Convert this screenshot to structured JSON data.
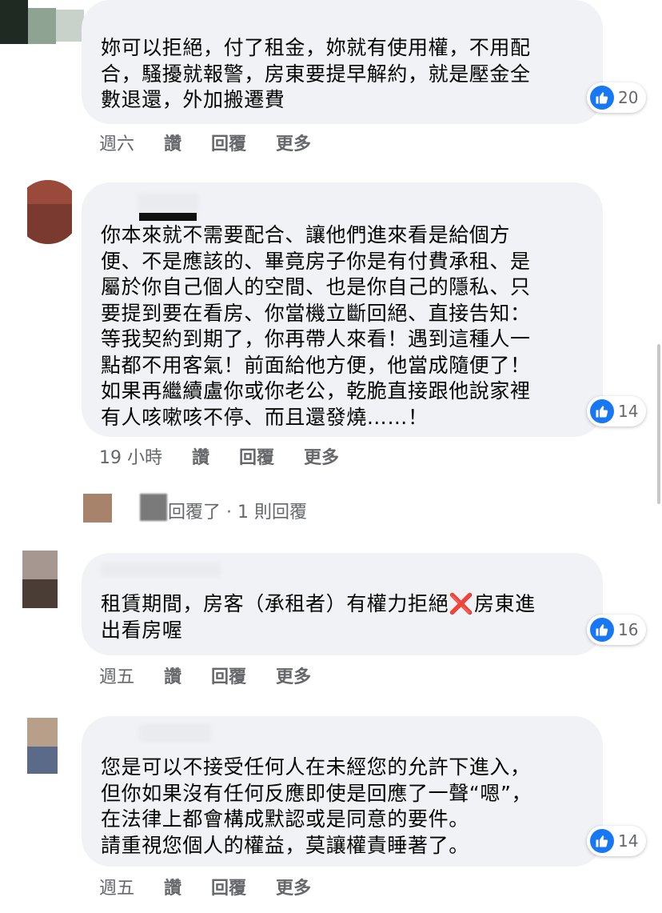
{
  "comments": [
    {
      "lines": [
        "妳可以拒絕，付了租金，妳就有使用權，不用配",
        "合，騷擾就報警，房東要提早解約，就是壓金全",
        "數退還，外加搬遷費"
      ],
      "time": "週六",
      "like": "讚",
      "reply": "回覆",
      "more": "更多",
      "reactions": "20"
    },
    {
      "lines": [
        "你本來就不需要配合、讓他們進來看是給個方",
        "便、不是應該的、畢竟房子你是有付費承租、是",
        "屬於你自己個人的空間、也是你自己的隱私、只",
        "要提到要在看房、你當機立斷回絕、直接告知：",
        "等我契約到期了，你再帶人來看！遇到這種人一",
        "點都不用客氣！前面給他方便，他當成隨便了！",
        "如果再繼續盧你或你老公，乾脆直接跟他說家裡",
        "有人咳嗽咳不停、而且還發燒……！"
      ],
      "time": "19 小時",
      "like": "讚",
      "reply": "回覆",
      "more": "更多",
      "reactions": "14",
      "replies_summary": "回覆了 · 1 則回覆"
    },
    {
      "line1_a": "租賃期間，房客（承租者）有權力拒絕",
      "line1_x": "❌",
      "line1_b": "房東進",
      "line2": "出看房喔",
      "time": "週五",
      "like": "讚",
      "reply": "回覆",
      "more": "更多",
      "reactions": "16"
    },
    {
      "lines": [
        "您是可以不接受任何人在未經您的允許下進入，",
        "但你如果沒有任何反應即使是回應了一聲“嗯”，",
        "在法律上都會構成默認或是同意的要件。",
        "請重視您個人的權益，莫讓權責睡著了。"
      ],
      "time": "週五",
      "like": "讚",
      "reply": "回覆",
      "more": "更多",
      "reactions": "14"
    }
  ],
  "colors": {
    "bubble": "#f0f2f5",
    "meta": "#65676b",
    "like_blue": "#1877f2"
  }
}
